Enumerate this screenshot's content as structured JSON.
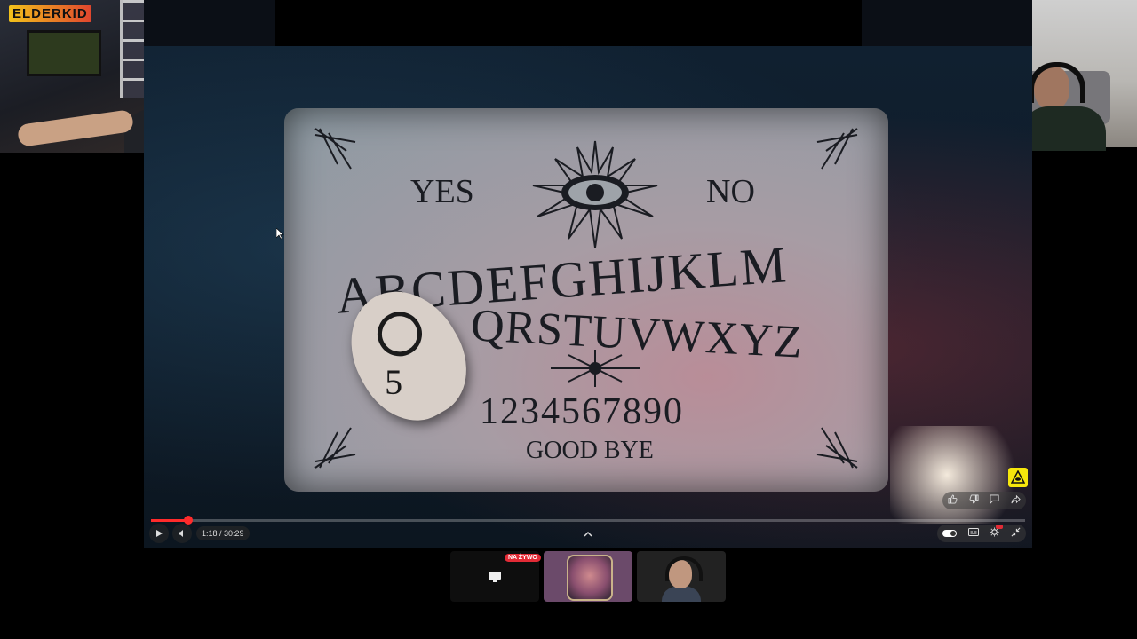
{
  "streamer_cam": {
    "logo_text": "ELDERKID"
  },
  "video": {
    "board": {
      "yes": "YES",
      "no": "NO",
      "alphabet_row1": "ABCDEFGHIJKLM",
      "alphabet_row2": "QRSTUVWXYZ",
      "numbers": "1234567890",
      "goodbye": "GOOD BYE",
      "planchette_digit": "5"
    },
    "time_display": "1:18 / 30:29",
    "progress_fraction": 0.043
  },
  "participants": {
    "live_badge": "NA ŻYWO"
  },
  "icons": {
    "play": "play-icon",
    "volume": "volume-icon",
    "expand": "chevron-up-icon",
    "like": "thumbs-up-icon",
    "dislike": "thumbs-down-icon",
    "comment": "comment-icon",
    "share": "share-icon",
    "autoplay": "toggle-icon",
    "subtitles": "subtitles-icon",
    "settings": "gear-icon",
    "minimize": "minimize-icon",
    "screen": "screen-share-icon"
  },
  "colors": {
    "progress": "#ff2b2b",
    "live": "#e22b36",
    "badge_yellow": "#f6e70c"
  }
}
